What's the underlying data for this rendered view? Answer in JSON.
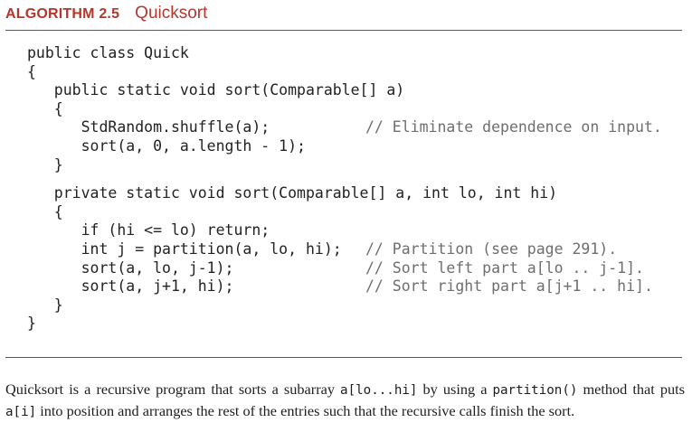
{
  "header": {
    "label": "ALGORITHM 2.5",
    "title": "Quicksort",
    "accent_color": "#b5362b"
  },
  "code": {
    "lines": [
      {
        "text": "public class Quick",
        "comment": ""
      },
      {
        "text": "{",
        "comment": ""
      },
      {
        "text": "   public static void sort(Comparable[] a)",
        "comment": ""
      },
      {
        "text": "   {",
        "comment": ""
      },
      {
        "text": "      StdRandom.shuffle(a);",
        "comment": "// Eliminate dependence on input."
      },
      {
        "text": "      sort(a, 0, a.length - 1);",
        "comment": ""
      },
      {
        "text": "   }",
        "comment": ""
      },
      {
        "text": "   private static void sort(Comparable[] a, int lo, int hi)",
        "comment": ""
      },
      {
        "text": "   {",
        "comment": ""
      },
      {
        "text": "      if (hi <= lo) return;",
        "comment": ""
      },
      {
        "text": "      int j = partition(a, lo, hi);",
        "comment": "// Partition (see page 291)."
      },
      {
        "text": "      sort(a, lo, j-1);",
        "comment": "// Sort left part a[lo .. j-1]."
      },
      {
        "text": "      sort(a, j+1, hi);",
        "comment": "// Sort right part a[j+1 .. hi]."
      },
      {
        "text": "   }",
        "comment": ""
      },
      {
        "text": "}",
        "comment": ""
      }
    ]
  },
  "caption": {
    "part1": "Quicksort is a recursive program that sorts a subarray ",
    "code1": "a[lo...hi]",
    "part2": " by using a ",
    "code2": "partition()",
    "part3": " method that puts ",
    "code3": "a[i]",
    "part4": " into position and arranges the rest of the entries such that the recursive calls finish the sort."
  }
}
